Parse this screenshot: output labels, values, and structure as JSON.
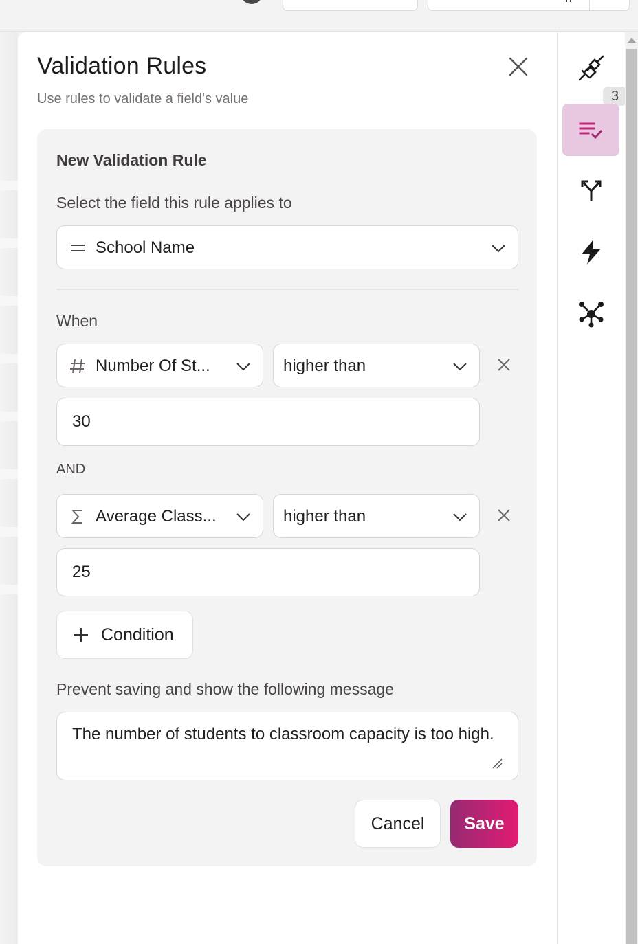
{
  "panel": {
    "title": "Validation Rules",
    "subtitle": "Use rules to validate a field's value"
  },
  "rule": {
    "heading": "New Validation Rule",
    "field_label": "Select the field this rule applies to",
    "field": {
      "icon": "text-field-icon",
      "value": "School Name"
    },
    "when_label": "When",
    "conditions": [
      {
        "field_icon": "number-field-icon",
        "field": "Number Of St...",
        "operator": "higher than",
        "value": "30"
      },
      {
        "field_icon": "formula-sum-icon",
        "field": "Average Class...",
        "operator": "higher than",
        "value": "25"
      }
    ],
    "joiner": "AND",
    "add_condition_label": "Condition",
    "message_label": "Prevent saving and show the following message",
    "message": "The number of students to classroom capacity is too high.",
    "cancel_label": "Cancel",
    "save_label": "Save"
  },
  "sidebar": {
    "items": [
      {
        "icon": "plug-icon",
        "badge": "3",
        "active": false
      },
      {
        "icon": "validation-list-check-icon",
        "active": true
      },
      {
        "icon": "branch-split-icon",
        "active": false
      },
      {
        "icon": "lightning-icon",
        "active": false
      },
      {
        "icon": "network-hub-icon",
        "active": false
      }
    ]
  },
  "colors": {
    "accent_start": "#962a72",
    "accent_end": "#e21b73",
    "active_bg": "#e8c8e1",
    "active_icon": "#c2247a"
  }
}
